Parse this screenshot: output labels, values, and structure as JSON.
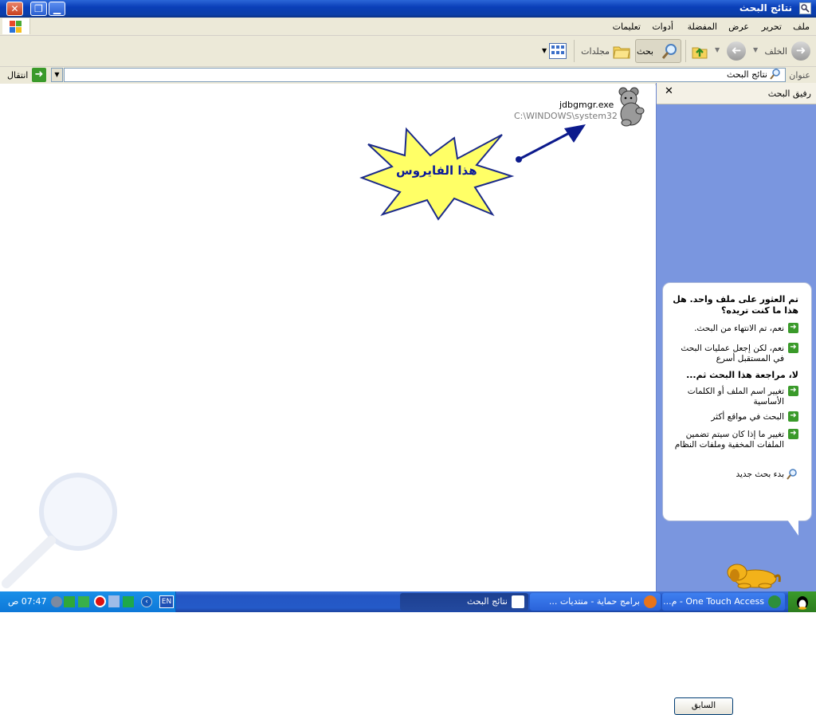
{
  "window": {
    "title": "نتائج البحث"
  },
  "menu": {
    "items": [
      "ملف",
      "تحرير",
      "عرض",
      "المفضلة",
      "أدوات",
      "تعليمات"
    ]
  },
  "toolbar": {
    "back_label": "الخلف",
    "search_label": "بحث",
    "folders_label": "مجلدات"
  },
  "address": {
    "label": "عنوان",
    "value": "نتائج البحث",
    "go_label": "انتقال"
  },
  "sidepane": {
    "title": "رفيق البحث",
    "question": "تم العثور على ملف واحد. هل هذا ما كنت تريده؟",
    "option1": "نعم، تم الانتهاء من البحث.",
    "option2": "نعم، لكن إجعل عمليات البحث في المستقبل أسرع",
    "subtitle": "لا، مراجعة هذا البحث ثم...",
    "option3": "تغيير اسم الملف أو الكلمات الأساسية",
    "option4": "البحث في مواقع أكثر",
    "option5": "تغيير ما إذا كان سيتم تضمين الملفات المخفية وملفات النظام",
    "new_search": "بدء بحث جديد",
    "back_button": "السابق"
  },
  "results": {
    "file_name": "jdbgmgr.exe",
    "file_path": "C:\\WINDOWS\\system32"
  },
  "annotation": {
    "text": "هذا الفايروس"
  },
  "taskbar": {
    "tasks": [
      "One Touch Access - م...",
      "برامج حماية - منتديات ...",
      "نتائج البحث"
    ],
    "lang": "EN",
    "clock": "07:47 ص"
  },
  "colors": {
    "title_bar": "#0a3fb8",
    "side_pane": "#7a96df",
    "taskbar": "#245ac8",
    "annotation_fill": "#ffff66",
    "arrow": "#0c1a8c"
  }
}
